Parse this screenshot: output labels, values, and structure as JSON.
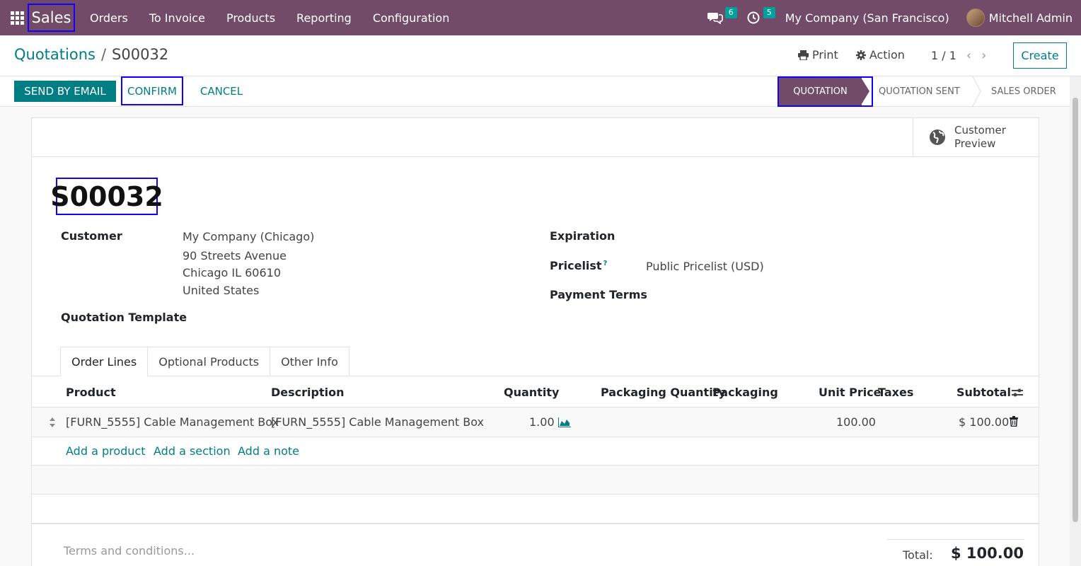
{
  "navbar": {
    "app_name": "Sales",
    "menu": [
      "Orders",
      "To Invoice",
      "Products",
      "Reporting",
      "Configuration"
    ],
    "messages_count": "6",
    "activities_count": "5",
    "company": "My Company (San Francisco)",
    "user": "Mitchell Admin",
    "color": "#714b67"
  },
  "control_panel": {
    "breadcrumb_parent": "Quotations",
    "breadcrumb_sep": "/",
    "breadcrumb_current": "S00032",
    "print_label": "Print",
    "action_label": "Action",
    "pager": "1 / 1",
    "prev_icon": "‹",
    "next_icon": "›",
    "create_label": "Create"
  },
  "statusbar": {
    "send_by_email": "SEND BY EMAIL",
    "confirm": "CONFIRM",
    "cancel": "CANCEL",
    "stages": [
      "QUOTATION",
      "QUOTATION SENT",
      "SALES ORDER"
    ],
    "active_stage": "QUOTATION"
  },
  "sheet": {
    "customer_preview": [
      "Customer",
      "Preview"
    ],
    "record_name": "S00032",
    "customer_label": "Customer",
    "customer_lines": [
      "My Company (Chicago)",
      "90 Streets Avenue",
      "Chicago IL 60610",
      "United States"
    ],
    "quotation_template_label": "Quotation Template",
    "expiration_label": "Expiration",
    "pricelist_label": "Pricelist",
    "pricelist_help": "?",
    "pricelist_value": "Public Pricelist (USD)",
    "payment_terms_label": "Payment Terms"
  },
  "tabs": [
    "Order Lines",
    "Optional Products",
    "Other Info"
  ],
  "order_lines": {
    "columns": [
      "Product",
      "Description",
      "Quantity",
      "Packaging Quantity",
      "Packaging",
      "Unit Price",
      "Taxes",
      "Subtotal"
    ],
    "rows": [
      {
        "product": "[FURN_5555] Cable Management Box",
        "description": "[FURN_5555] Cable Management Box",
        "quantity": "1.00",
        "packaging_quantity": "",
        "packaging": "",
        "unit_price": "100.00",
        "taxes": "",
        "subtotal": "$ 100.00"
      }
    ],
    "add_product": "Add a product",
    "add_section": "Add a section",
    "add_note": "Add a note"
  },
  "footer": {
    "terms_placeholder": "Terms and conditions...",
    "total_label": "Total:",
    "total_value": "$ 100.00"
  }
}
